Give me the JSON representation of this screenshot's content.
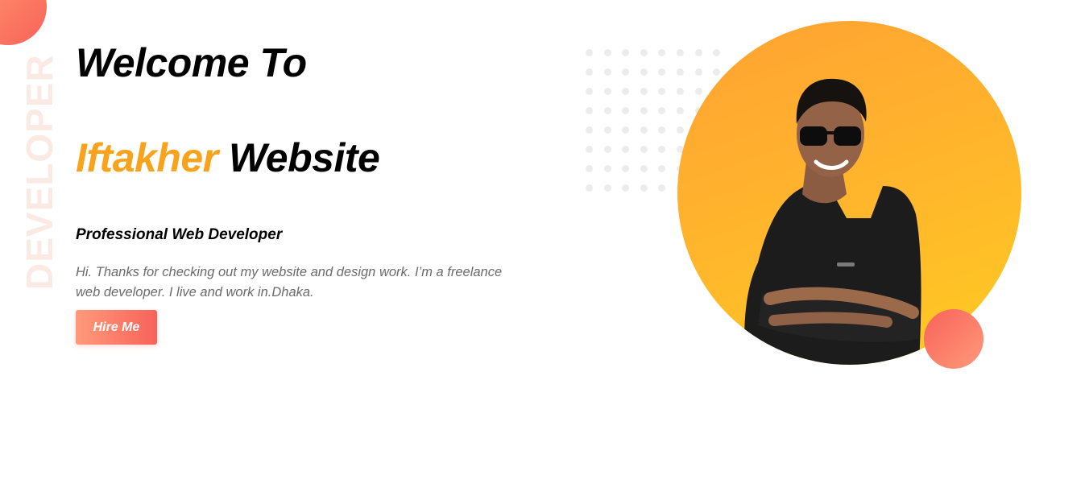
{
  "hero": {
    "welcome": "Welcome To",
    "name_accent": "Iftakher",
    "name_rest": " Website",
    "role": "Professional Web Developer",
    "intro": "Hi. Thanks for checking out my website and design work. I’m a freelance web developer. I live and work in.Dhaka.",
    "cta_label": "Hire Me"
  },
  "decor": {
    "vertical_word": "DEVELOPER"
  },
  "colors": {
    "accent": "#f9a21b",
    "button": "#f8625a",
    "portrait_bg": "#ffb52c"
  },
  "icons": {
    "portrait": "person-photo"
  }
}
